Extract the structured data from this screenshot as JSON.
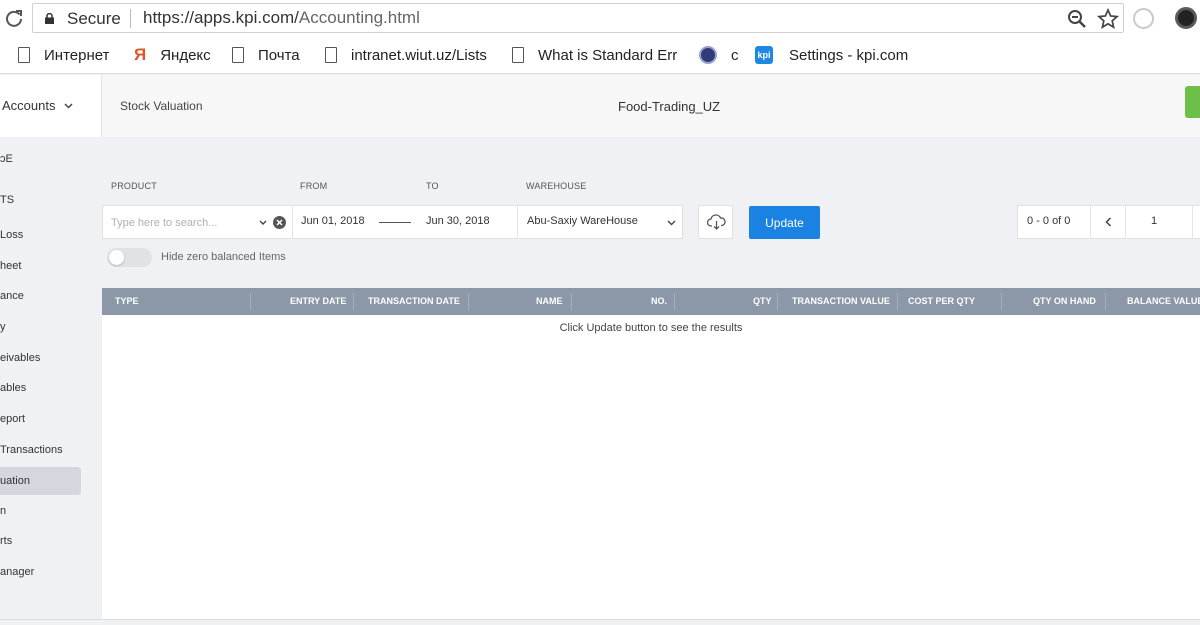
{
  "browser": {
    "secure_label": "Secure",
    "url_host": "https://apps.kpi.com/",
    "url_path": "Accounting.html",
    "bookmarks": [
      {
        "label": "Интернет",
        "icon": "document-icon"
      },
      {
        "label": "Яндекс",
        "icon": "yandex-icon"
      },
      {
        "label": "Почта",
        "icon": "document-icon"
      },
      {
        "label": "intranet.wiut.uz/Lists",
        "icon": "document-icon"
      },
      {
        "label": "What is Standard Err",
        "icon": "document-icon"
      },
      {
        "label": "c",
        "icon": "globe-icon"
      },
      {
        "label": "Settings - kpi.com",
        "icon": "kpi-icon"
      }
    ],
    "kpi_icon_text": "kpi"
  },
  "header": {
    "accounts_label": "Accounts",
    "page_title": "Stock Valuation",
    "company": "Food-Trading_UZ"
  },
  "sidebar": {
    "items": [
      {
        "label": "ɔE"
      },
      {
        "label": "TS"
      },
      {
        "label": "Loss"
      },
      {
        "label": "heet"
      },
      {
        "label": "ance"
      },
      {
        "label": "y"
      },
      {
        "label": "eivables"
      },
      {
        "label": "ables"
      },
      {
        "label": "eport"
      },
      {
        "label": "Transactions"
      },
      {
        "label": "uation",
        "active": true
      },
      {
        "label": "n"
      },
      {
        "label": "rts"
      },
      {
        "label": "anager"
      }
    ]
  },
  "filters": {
    "product_label": "PRODUCT",
    "from_label": "FROM",
    "to_label": "TO",
    "warehouse_label": "WAREHOUSE",
    "search_placeholder": "Type here to search...",
    "from_date": "Jun 01, 2018",
    "to_date": "Jun 30, 2018",
    "warehouse": "Abu-Saxiy WareHouse",
    "update_label": "Update",
    "hide_zero_label": "Hide zero balanced Items"
  },
  "pager": {
    "count": "0 - 0 of 0",
    "page": "1"
  },
  "table": {
    "columns": [
      "TYPE",
      "ENTRY DATE",
      "TRANSACTION DATE",
      "NAME",
      "NO.",
      "QTY",
      "TRANSACTION VALUE",
      "COST PER QTY",
      "QTY ON HAND",
      "BALANCE VALUE"
    ],
    "empty_message": "Click Update button to see the results"
  },
  "colors": {
    "primary": "#1a82e2",
    "table_header": "#8c98a8",
    "green": "#6cc04a"
  }
}
